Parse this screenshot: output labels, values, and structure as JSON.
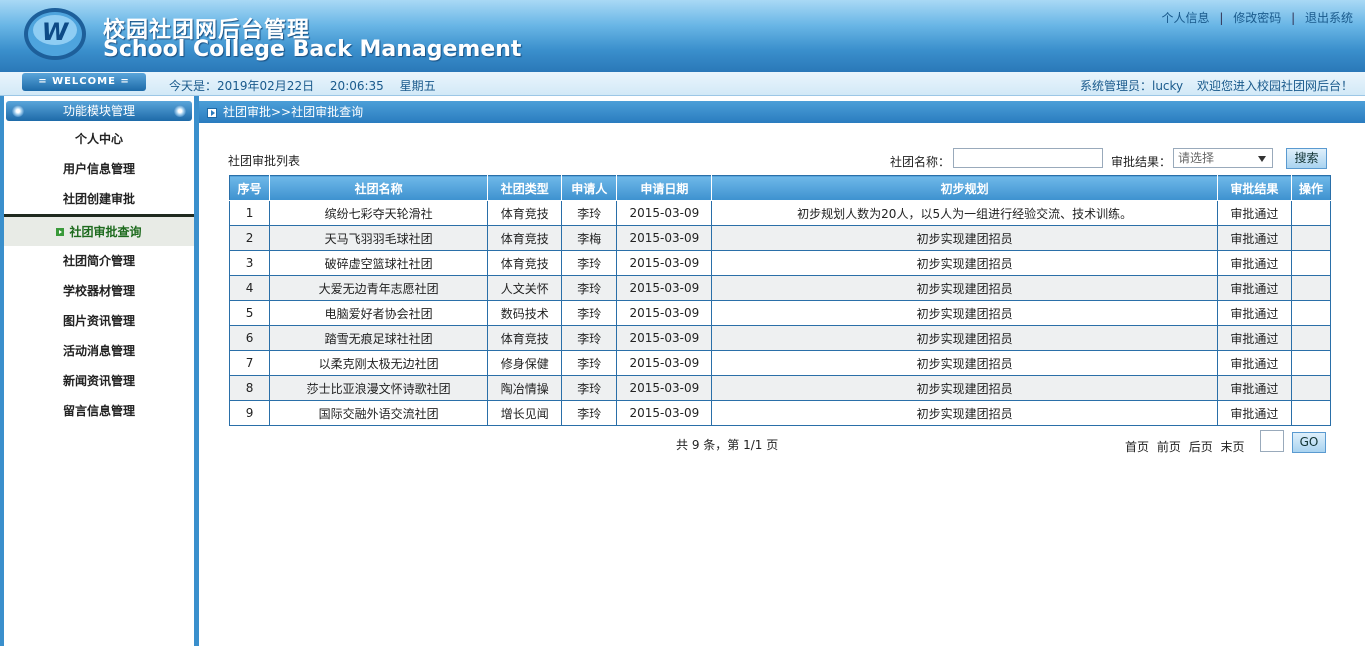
{
  "header": {
    "title_cn": "校园社团网后台管理",
    "title_en": "School College Back Management",
    "links": [
      "个人信息",
      "修改密码",
      "退出系统"
    ],
    "separator": "|"
  },
  "infobar": {
    "welcome": "= WELCOME =",
    "date_label": "今天是：2019年02月22日",
    "time": "20:06:35",
    "weekday": "星期五",
    "admin": "系统管理员：lucky",
    "greeting": "欢迎您进入校园社团网后台！"
  },
  "sidebar": {
    "title": "功能模块管理",
    "items": [
      {
        "label": "个人中心"
      },
      {
        "label": "用户信息管理"
      },
      {
        "label": "社团创建审批"
      },
      {
        "label": "社团审批查询",
        "active": true
      },
      {
        "label": "社团简介管理"
      },
      {
        "label": "学校器材管理"
      },
      {
        "label": "图片资讯管理"
      },
      {
        "label": "活动消息管理"
      },
      {
        "label": "新闻资讯管理"
      },
      {
        "label": "留言信息管理"
      }
    ]
  },
  "main": {
    "breadcrumb": "社团审批>>社团审批查询",
    "list_title": "社团审批列表",
    "search": {
      "name_label": "社团名称：",
      "name_value": "",
      "result_label": "审批结果：",
      "result_selected": "请选择",
      "search_button": "搜索"
    },
    "table": {
      "headers": [
        "序号",
        "社团名称",
        "社团类型",
        "申请人",
        "申请日期",
        "初步规划",
        "审批结果",
        "操作"
      ],
      "rows": [
        [
          "1",
          "缤纷七彩夺天轮滑社",
          "体育竞技",
          "李玲",
          "2015-03-09",
          "初步规划人数为20人，以5人为一组进行经验交流、技术训练。",
          "审批通过",
          ""
        ],
        [
          "2",
          "天马飞羽羽毛球社团",
          "体育竞技",
          "李梅",
          "2015-03-09",
          "初步实现建团招员",
          "审批通过",
          ""
        ],
        [
          "3",
          "破碎虚空篮球社社团",
          "体育竞技",
          "李玲",
          "2015-03-09",
          "初步实现建团招员",
          "审批通过",
          ""
        ],
        [
          "4",
          "大爱无边青年志愿社团",
          "人文关怀",
          "李玲",
          "2015-03-09",
          "初步实现建团招员",
          "审批通过",
          ""
        ],
        [
          "5",
          "电脑爱好者协会社团",
          "数码技术",
          "李玲",
          "2015-03-09",
          "初步实现建团招员",
          "审批通过",
          ""
        ],
        [
          "6",
          "踏雪无痕足球社社团",
          "体育竞技",
          "李玲",
          "2015-03-09",
          "初步实现建团招员",
          "审批通过",
          ""
        ],
        [
          "7",
          "以柔克刚太极无边社团",
          "修身保健",
          "李玲",
          "2015-03-09",
          "初步实现建团招员",
          "审批通过",
          ""
        ],
        [
          "8",
          "莎士比亚浪漫文怀诗歌社团",
          "陶冶情操",
          "李玲",
          "2015-03-09",
          "初步实现建团招员",
          "审批通过",
          ""
        ],
        [
          "9",
          "国际交融外语交流社团",
          "增长见闻",
          "李玲",
          "2015-03-09",
          "初步实现建团招员",
          "审批通过",
          ""
        ]
      ]
    },
    "pager": {
      "summary": "共 9 条，第 1/1 页",
      "first": "首页",
      "prev": "前页",
      "next": "后页",
      "last": "末页",
      "page_value": "",
      "go": "GO"
    }
  },
  "colors": {
    "primary": "#3a8fcc",
    "header_text": "#1a5a8c",
    "active_menu": "#1e6b1e"
  }
}
